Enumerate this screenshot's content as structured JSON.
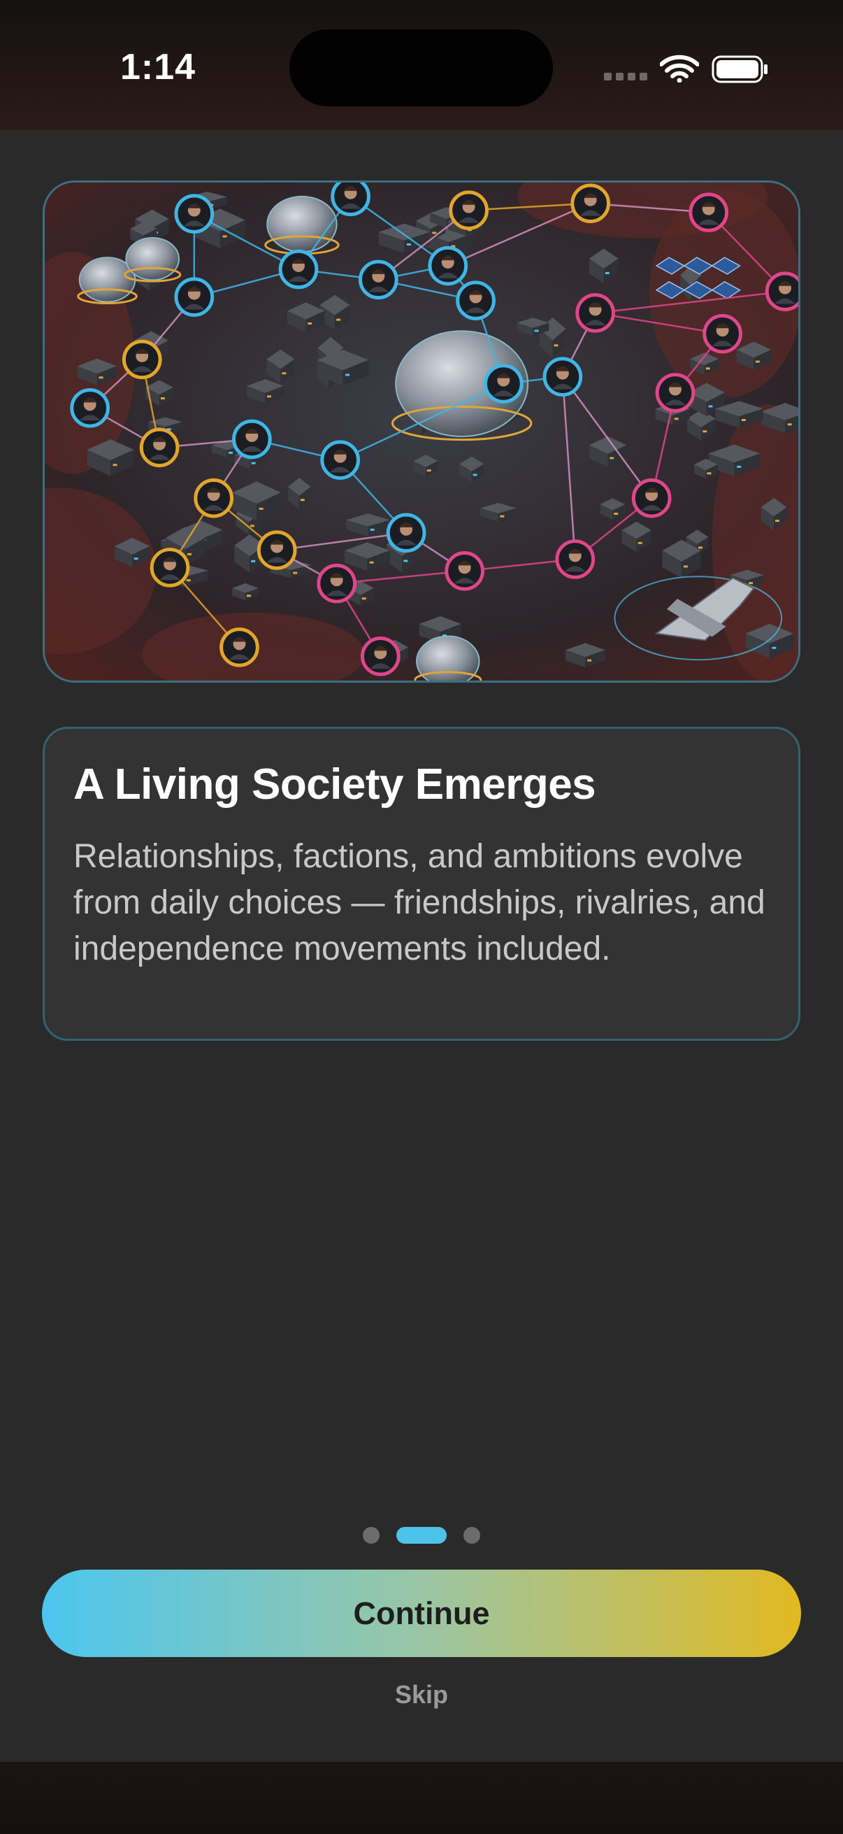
{
  "status_bar": {
    "time": "1:14",
    "icons": [
      "cellular-signal-icon",
      "wifi-icon",
      "battery-icon"
    ]
  },
  "onboarding": {
    "hero_image_description": "isometric colony network illustration",
    "title": "A Living Society Emerges",
    "body": "Relationships, factions, and ambitions evolve from daily choices — friendships, rivalries, and independence movements included.",
    "pager": {
      "total_pages": 3,
      "current_page": 2
    },
    "continue_label": "Continue",
    "skip_label": "Skip"
  },
  "colors": {
    "background": "#2a2a2a",
    "card_border": "#35616e",
    "accent_blue": "#4dc3ea",
    "accent_gold": "#e1b921",
    "node_pink": "#e0468a"
  }
}
